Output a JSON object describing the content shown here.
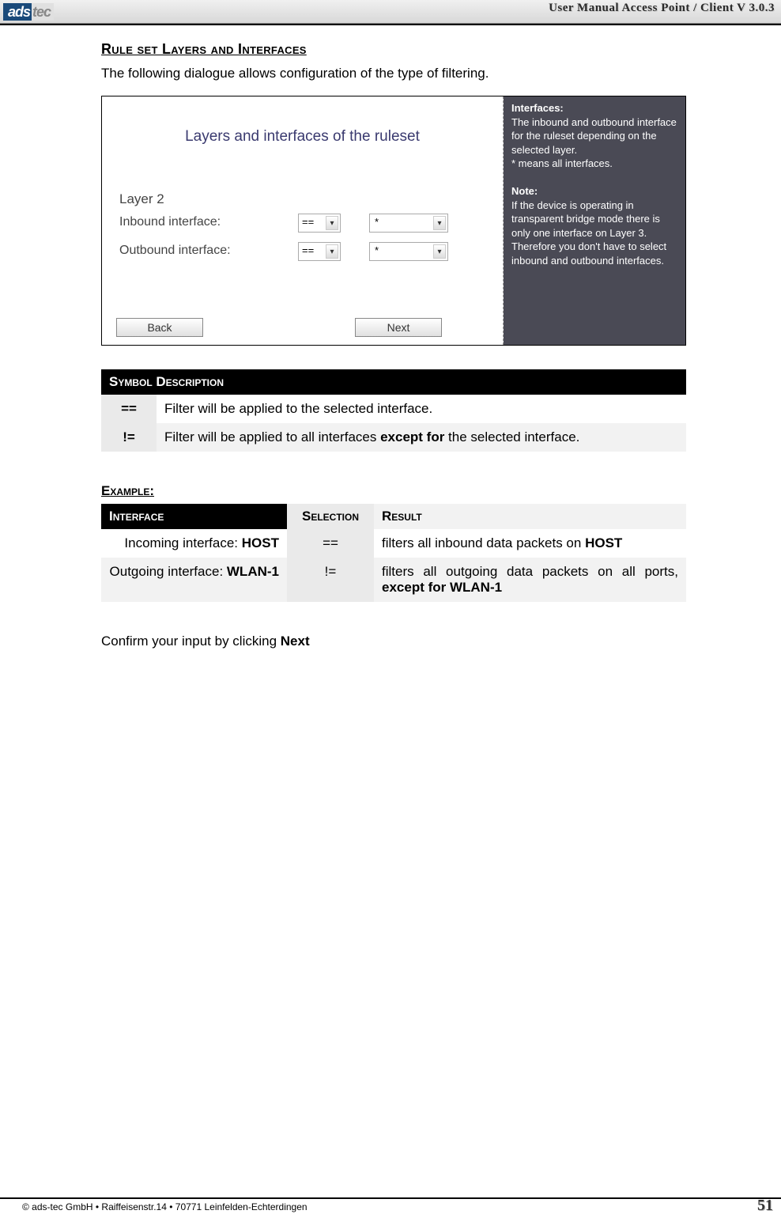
{
  "header": {
    "logo_ads": "ads",
    "logo_tec": "tec",
    "title": "User Manual Access  Point / Client V 3.0.3"
  },
  "main": {
    "heading": "Rule set Layers and Interfaces",
    "intro": "The following dialogue allows configuration of the type of filtering.",
    "screenshot": {
      "title": "Layers and interfaces of the ruleset",
      "layer_label": "Layer 2",
      "inbound_label": "Inbound interface:",
      "outbound_label": "Outbound interface:",
      "op_val": "==",
      "iface_val": "*",
      "back_btn": "Back",
      "next_btn": "Next",
      "side_title": "Interfaces:",
      "side_p1": "The inbound and outbound interface for the ruleset depending on the selected layer.",
      "side_p1b": "* means all interfaces.",
      "side_title2": "Note:",
      "side_p2": "If the device is operating in transparent bridge mode there is only one interface on Layer 3. Therefore you don't have to select inbound and outbound interfaces."
    },
    "symbol_table": {
      "header": "Symbol Description",
      "rows": [
        {
          "sym": "==",
          "desc_pre": "Filter will be applied to the selected interface."
        },
        {
          "sym": "!=",
          "desc_pre": "Filter will be applied to all interfaces ",
          "desc_bold": "except for",
          "desc_post": " the selected interface."
        }
      ]
    },
    "example": {
      "heading": "Example:",
      "headers": {
        "c1": "Interface",
        "c2": "Selection",
        "c3": "Result"
      },
      "rows": [
        {
          "c1_pre": "Incoming interface: ",
          "c1_bold": "HOST",
          "c2": "==",
          "c3_pre": "filters all inbound data packets on ",
          "c3_bold": "HOST"
        },
        {
          "c1_pre": "Outgoing interface: ",
          "c1_bold": "WLAN-1",
          "c2": "!=",
          "c3_pre": "filters all outgoing data packets on all ports, ",
          "c3_bold": "except for WLAN-1"
        }
      ]
    },
    "confirm_pre": "Confirm your input by clicking ",
    "confirm_bold": "Next"
  },
  "footer": {
    "copyright": "© ads-tec GmbH • Raiffeisenstr.14 • 70771 Leinfelden-Echterdingen",
    "page": "51"
  }
}
